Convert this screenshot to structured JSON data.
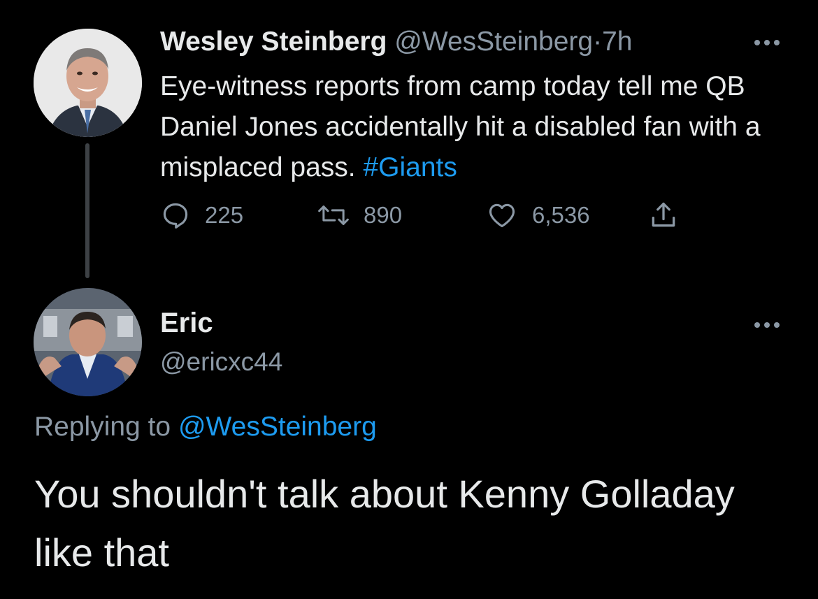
{
  "original_tweet": {
    "author_name": "Wesley Steinberg",
    "author_handle": "@WesSteinberg",
    "separator": "·",
    "time": "7h",
    "avatar_icon": "person-photo-avatar",
    "text_parts": [
      "Eye-witness reports from camp today tell me QB Daniel Jones accidentally hit a disabled fan with a misplaced pass. "
    ],
    "hashtag": "#Giants",
    "actions": {
      "replies": "225",
      "retweets": "890",
      "likes": "6,536"
    }
  },
  "reply_tweet": {
    "author_name": "Eric",
    "author_handle": "@ericxc44",
    "avatar_icon": "person-photo-avatar",
    "replying_label": "Replying to",
    "replying_to": "@WesSteinberg",
    "text": "You shouldn't talk about Kenny Golladay like that"
  },
  "colors": {
    "background": "#000000",
    "text": "#e7e9ea",
    "muted": "#8b98a5",
    "accent": "#1d9bf0"
  }
}
